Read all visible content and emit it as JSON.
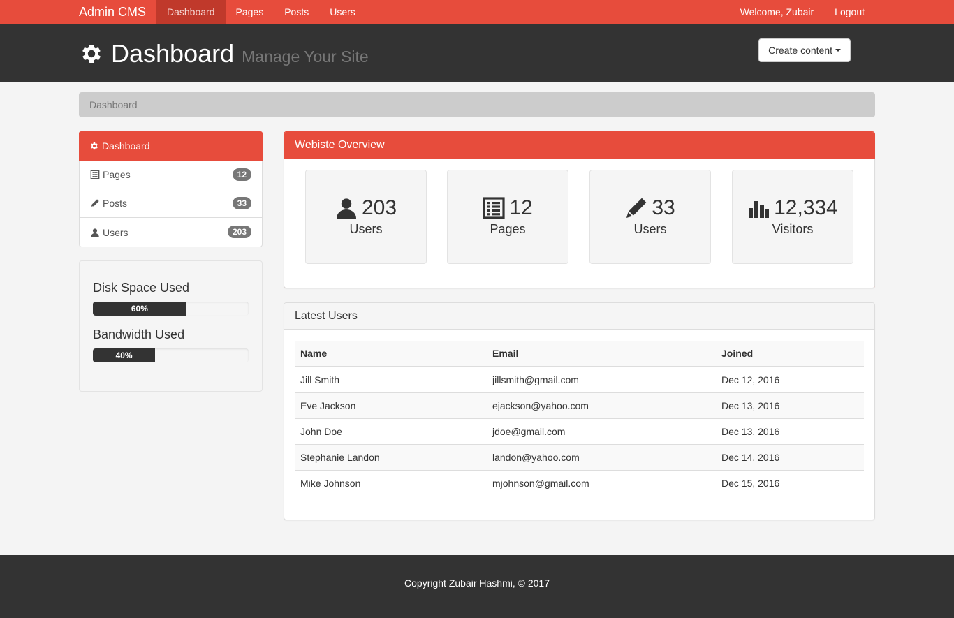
{
  "nav": {
    "brand": "Admin CMS",
    "links": [
      "Dashboard",
      "Pages",
      "Posts",
      "Users"
    ],
    "welcome": "Welcome, Zubair",
    "logout": "Logout"
  },
  "header": {
    "title": "Dashboard",
    "subtitle": "Manage Your Site",
    "create_label": "Create content"
  },
  "breadcrumb": "Dashboard",
  "sidebar": {
    "items": [
      {
        "label": "Dashboard",
        "icon": "gear-icon"
      },
      {
        "label": "Pages",
        "icon": "list-icon",
        "count": "12"
      },
      {
        "label": "Posts",
        "icon": "pencil-icon",
        "count": "33"
      },
      {
        "label": "Users",
        "icon": "user-icon",
        "count": "203"
      }
    ]
  },
  "usage": {
    "disk_title": "Disk Space Used",
    "disk_percent": 60,
    "disk_label": "60%",
    "bandwidth_title": "Bandwidth Used",
    "bandwidth_percent": 40,
    "bandwidth_label": "40%"
  },
  "overview": {
    "title": "Webiste Overview",
    "stats": [
      {
        "value": "203",
        "label": "Users",
        "icon": "user-icon"
      },
      {
        "value": "12",
        "label": "Pages",
        "icon": "list-icon"
      },
      {
        "value": "33",
        "label": "Users",
        "icon": "pencil-icon"
      },
      {
        "value": "12,334",
        "label": "Visitors",
        "icon": "bar-chart-icon"
      }
    ]
  },
  "latest_users": {
    "title": "Latest Users",
    "columns": [
      "Name",
      "Email",
      "Joined"
    ],
    "rows": [
      [
        "Jill Smith",
        "jillsmith@gmail.com",
        "Dec 12, 2016"
      ],
      [
        "Eve Jackson",
        "ejackson@yahoo.com",
        "Dec 13, 2016"
      ],
      [
        "John Doe",
        "jdoe@gmail.com",
        "Dec 13, 2016"
      ],
      [
        "Stephanie Landon",
        "landon@yahoo.com",
        "Dec 14, 2016"
      ],
      [
        "Mike Johnson",
        "mjohnson@gmail.com",
        "Dec 15, 2016"
      ]
    ]
  },
  "footer": "Copyright Zubair Hashmi, © 2017",
  "colors": {
    "accent": "#e74c3c",
    "dark": "#333333"
  }
}
